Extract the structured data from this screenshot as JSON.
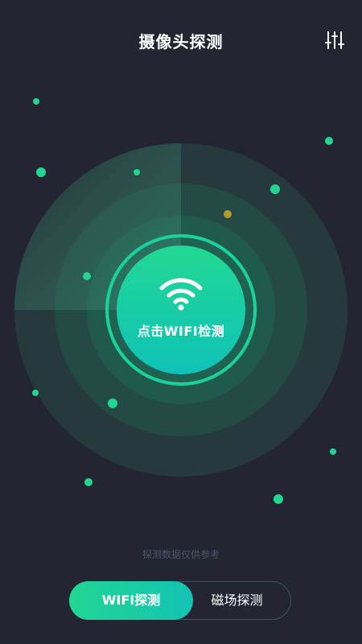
{
  "header": {
    "title": "摄像头探测",
    "settings_icon": "sliders-icon"
  },
  "scanner": {
    "label": "点击WIFI检测",
    "icon": "wifi-icon"
  },
  "disclaimer": "探测数据仅供参考",
  "modes": [
    {
      "label": "WIFI探测",
      "active": true
    },
    {
      "label": "磁场探测",
      "active": false
    }
  ],
  "colors": {
    "background": "#232533",
    "accent_green": "#22d693",
    "accent_teal": "#12c4b3",
    "highlight_dot": "#b59a2a"
  }
}
